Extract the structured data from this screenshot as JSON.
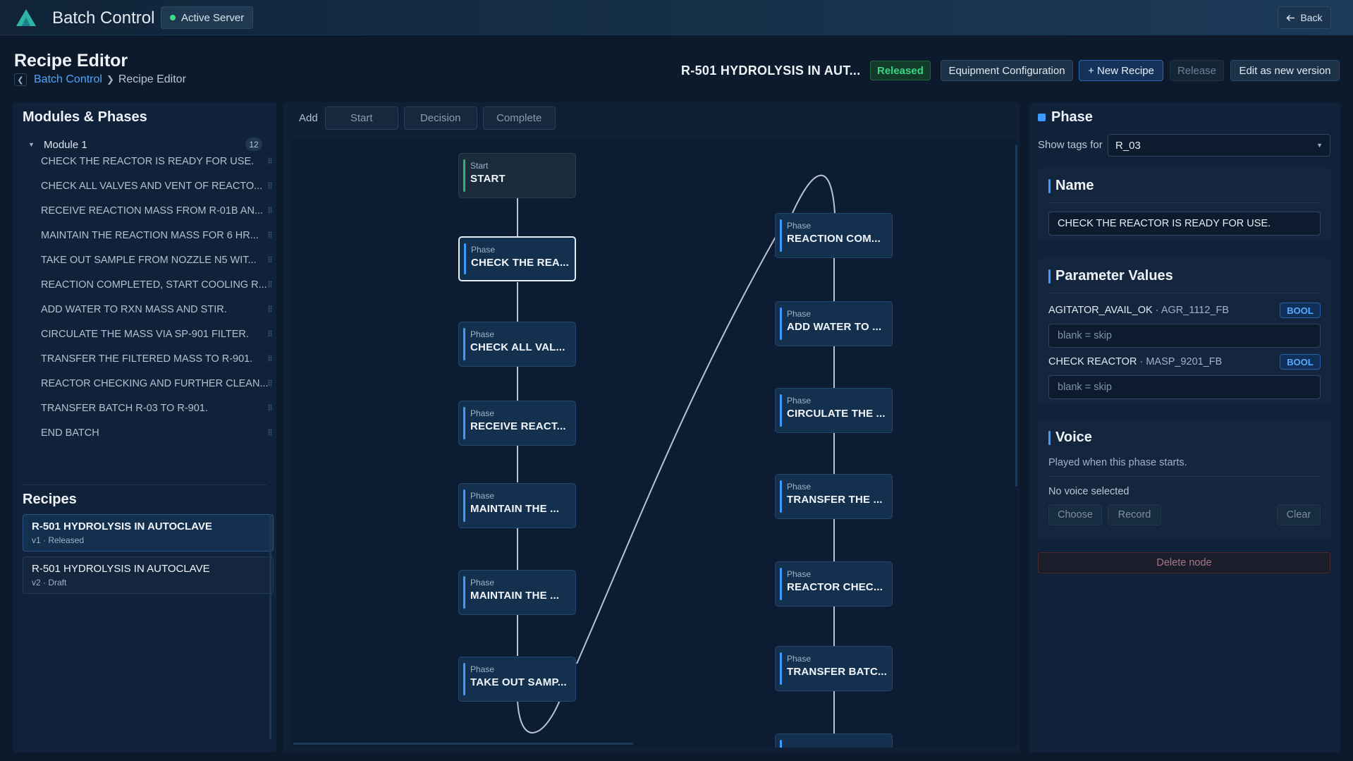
{
  "app": {
    "title": "Batch Control",
    "server_status": "Active Server",
    "back_label": "Back",
    "accent": "#3d9bff",
    "status_green": "#37d67f"
  },
  "page": {
    "title": "Recipe Editor",
    "breadcrumb": [
      "Batch Control",
      "Recipe Editor"
    ]
  },
  "header": {
    "recipe_name": "R-501 HYDROLYSIS IN AUT...",
    "status": "Released",
    "buttons": {
      "equipment": "Equipment Configuration",
      "new_recipe": "+ New Recipe",
      "release": "Release",
      "edit_new_version": "Edit as new version"
    }
  },
  "modules": {
    "title": "Modules & Phases",
    "module_name": "Module 1",
    "module_count": "12",
    "phases": [
      "CHECK THE REACTOR IS READY FOR USE.",
      "CHECK ALL VALVES AND VENT OF REACTO...",
      "RECEIVE REACTION MASS FROM R-01B AN...",
      "MAINTAIN THE REACTION MASS FOR 6 HR...",
      "TAKE OUT SAMPLE FROM NOZZLE N5 WIT...",
      "REACTION COMPLETED, START COOLING R...",
      "ADD WATER TO RXN MASS AND STIR.",
      "CIRCULATE THE MASS VIA SP-901 FILTER.",
      "TRANSFER THE FILTERED MASS TO R-901.",
      "REACTOR CHECKING AND FURTHER CLEAN...",
      "TRANSFER BATCH R-03 TO R-901.",
      "END BATCH"
    ]
  },
  "recipes": {
    "title": "Recipes",
    "items": [
      {
        "name": "R-501 HYDROLYSIS IN AUTOCLAVE",
        "meta": "v1 · Released"
      },
      {
        "name": "R-501 HYDROLYSIS IN AUTOCLAVE",
        "meta": "v2 · Draft"
      }
    ]
  },
  "toolbar": {
    "add_label": "Add",
    "buttons": [
      "Start",
      "Decision",
      "Complete"
    ]
  },
  "flow": {
    "nodes": [
      {
        "type": "Start",
        "title": "START"
      },
      {
        "type": "Phase",
        "title": "CHECK THE REA..."
      },
      {
        "type": "Phase",
        "title": "CHECK ALL VAL..."
      },
      {
        "type": "Phase",
        "title": "RECEIVE REACT..."
      },
      {
        "type": "Phase",
        "title": "MAINTAIN THE ..."
      },
      {
        "type": "Phase",
        "title": "MAINTAIN THE ..."
      },
      {
        "type": "Phase",
        "title": "TAKE OUT SAMP..."
      },
      {
        "type": "Phase",
        "title": "REACTION COM..."
      },
      {
        "type": "Phase",
        "title": "ADD WATER TO ..."
      },
      {
        "type": "Phase",
        "title": "CIRCULATE THE ..."
      },
      {
        "type": "Phase",
        "title": "TRANSFER THE ..."
      },
      {
        "type": "Phase",
        "title": "REACTOR CHEC..."
      },
      {
        "type": "Phase",
        "title": "TRANSFER BATC..."
      }
    ]
  },
  "inspector": {
    "title": "Phase",
    "show_tags_label": "Show tags for",
    "show_tags_value": "R_03",
    "name_title": "Name",
    "name_value": "CHECK THE REACTOR IS READY FOR USE.",
    "params_title": "Parameter Values",
    "params": [
      {
        "name": "AGITATOR_AVAIL_OK",
        "tag": "AGR_1112_FB",
        "type": "BOOL",
        "placeholder": "blank = skip"
      },
      {
        "name": "CHECK REACTOR",
        "tag": "MASP_9201_FB",
        "type": "BOOL",
        "placeholder": "blank = skip"
      }
    ],
    "voice_title": "Voice",
    "voice_desc": "Played when this phase starts.",
    "voice_status": "No voice selected",
    "choose_label": "Choose",
    "record_label": "Record",
    "clear_label": "Clear",
    "delete_label": "Delete node"
  }
}
